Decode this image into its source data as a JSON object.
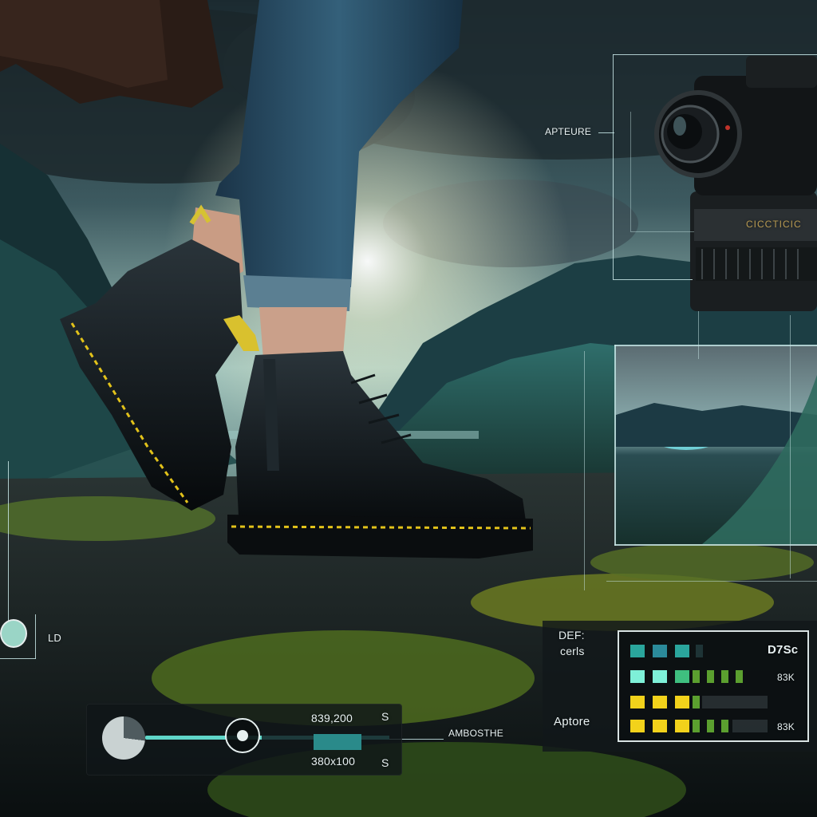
{
  "hud": {
    "aperture_callout": "APTEURE",
    "left_readout": "LD",
    "slider": {
      "top_value": "839,200",
      "top_suffix": "S",
      "bottom_value": "380x100",
      "bottom_suffix": "S",
      "callout": "AMBOSTHE",
      "level": 0.45
    },
    "meter": {
      "title_line1": "DEF:",
      "title_line2": "cerls",
      "caption": "Aptore",
      "headline": "D7Sc",
      "row_values": [
        "83K",
        "83K"
      ]
    },
    "camera_brand": "CICCTICIC"
  },
  "colors": {
    "hud_line": "#c8e6e6",
    "teal": "#43bfb0",
    "mint": "#7ef0d8",
    "yellow": "#f2d21b",
    "green": "#5b9f2f",
    "boot": "#0d1114",
    "sky": "#7fa6a3"
  }
}
